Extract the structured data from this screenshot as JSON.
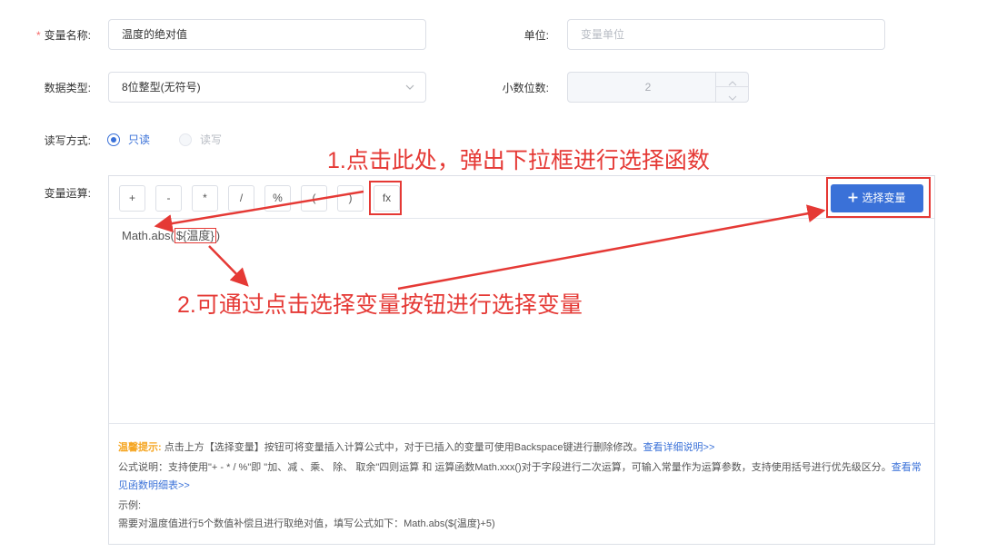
{
  "form": {
    "name_label": "变量名称:",
    "name_required": "*",
    "name_value": "温度的绝对值",
    "unit_label": "单位:",
    "unit_placeholder": "变量单位",
    "type_label": "数据类型:",
    "type_value": "8位整型(无符号)",
    "decimal_label": "小数位数:",
    "decimal_value": "2",
    "rw_label": "读写方式:",
    "rw_options": [
      {
        "label": "只读",
        "checked": true
      },
      {
        "label": "读写",
        "checked": false,
        "disabled": true
      }
    ],
    "calc_label": "变量运算:"
  },
  "toolbar": {
    "buttons": [
      "+",
      "-",
      "*",
      "/",
      "%",
      "(",
      ")",
      "fx"
    ],
    "add_variable_label": "选择变量",
    "add_icon": "plus-icon"
  },
  "formula": {
    "prefix": "Math.abs(",
    "variable": "${温度}",
    "suffix": ")"
  },
  "tips": {
    "warm_title": "温馨提示:",
    "line1": "点击上方【选择变量】按钮可将变量插入计算公式中，对于已插入的变量可使用Backspace键进行删除修改。",
    "line1_link": "查看详细说明>>",
    "line2": "公式说明：支持使用\"+ - * / %\"即 \"加、减 、乘、 除、 取余\"四则运算 和 运算函数Math.xxx()对于字段进行二次运算，可输入常量作为运算参数，支持使用括号进行优先级区分。",
    "line2_link": "查看常见函数明细表>>",
    "line3": "示例:",
    "line4": "需要对温度值进行5个数值补偿且进行取绝对值，填写公式如下：Math.abs(${温度}+5)"
  },
  "annotations": {
    "step1": "1.点击此处，弹出下拉框进行选择函数",
    "step2": "2.可通过点击选择变量按钮进行选择变量",
    "color": "#e53935"
  },
  "colors": {
    "primary": "#3a71d8",
    "annotation": "#e53935",
    "warm": "#f5a623"
  }
}
